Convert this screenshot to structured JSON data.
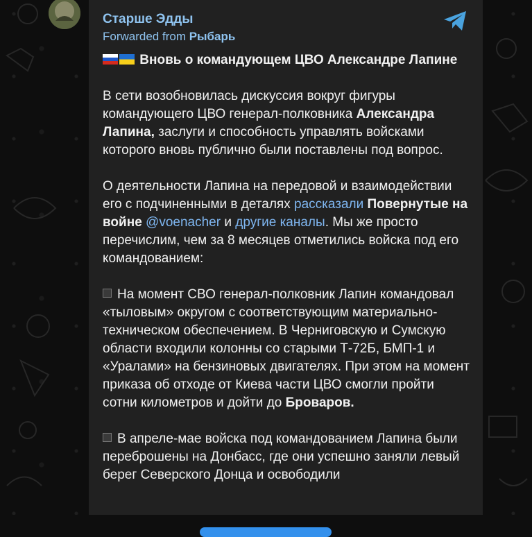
{
  "post": {
    "channel_name": "Старше Эдды",
    "forwarded_prefix": "Forwarded from ",
    "forwarded_source": "Рыбарь",
    "title": "Вновь о командующем ЦВО Александре Лапине"
  },
  "paragraph1": {
    "t1": "В сети возобновилась дискуссия вокруг фигуры командующего ЦВО генерал-полковника ",
    "b1": "Александра Лапина,",
    "t2": " заслуги и способность управлять войсками которого вновь публично были поставлены под вопрос."
  },
  "paragraph2": {
    "t1": "О деятельности Лапина на передовой и взаимодействии его с подчиненными в деталях ",
    "link1": "рассказали",
    "t2": " ",
    "b1": "Повернутые на войне",
    "t3": " ",
    "link2": "@voenacher",
    "t4": " и ",
    "link3": "другие каналы",
    "t5": ". Мы же просто перечислим, чем за 8 месяцев отметились войска под его командованием:"
  },
  "paragraph3": {
    "t1": "На момент СВО генерал-полковник Лапин командовал «тыловым» округом с соответствующим материально-техническом обеспечением. В Черниговскую и Сумскую области входили колонны со старыми Т-72Б, БМП-1 и «Уралами» на бензиновых двигателях. При этом на момент приказа об отходе от Киева части ЦВО смогли пройти сотни километров и дойти до ",
    "b1": "Броваров."
  },
  "paragraph4": {
    "t1": "В апреле-мае войска под командованием Лапина были переброшены на Донбасс, где они успешно заняли левый берег Северского Донца и освободили"
  },
  "colors": {
    "background": "#0e0e0e",
    "bubble": "#212121",
    "accent": "#8fc3ef",
    "link": "#7fb6f0",
    "text": "#f1f1f1",
    "button": "#3390ec"
  },
  "icons": [
    "channel-avatar",
    "share-icon",
    "russia-flag-icon",
    "ukraine-flag-icon",
    "black-square-icon"
  ]
}
